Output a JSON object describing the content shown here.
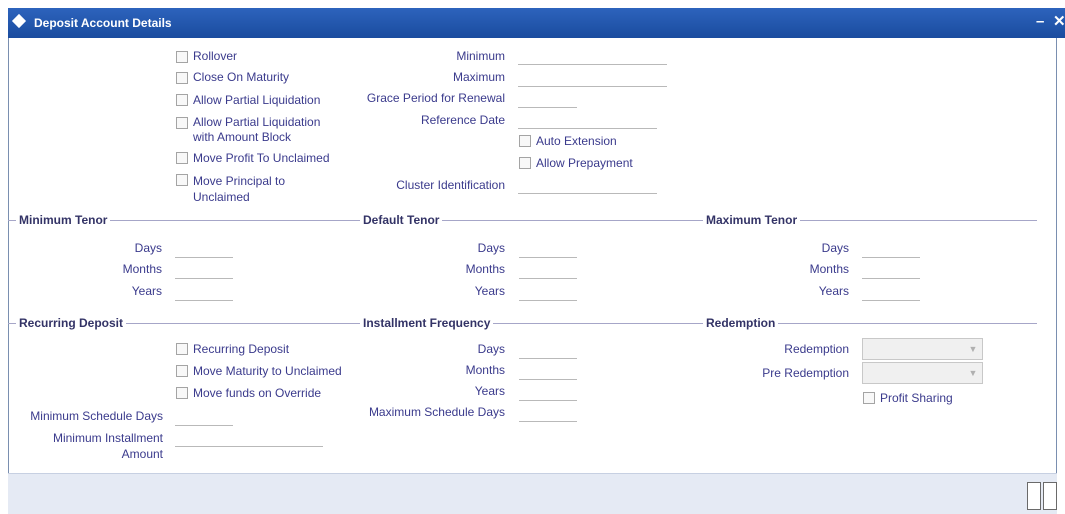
{
  "window": {
    "title": "Deposit Account Details",
    "minimize": "–",
    "close": "✕"
  },
  "flags": {
    "rollover": "Rollover",
    "close_on_maturity": "Close On Maturity",
    "allow_partial_liq": "Allow Partial Liquidation",
    "allow_partial_liq_block": "Allow Partial Liquidation\nwith Amount Block",
    "move_profit": "Move Profit To Unclaimed",
    "move_principal": "Move Principal to\nUnclaimed"
  },
  "fields": {
    "minimum": "Minimum",
    "maximum": "Maximum",
    "grace_period": "Grace Period for Renewal",
    "reference_date": "Reference Date",
    "auto_extension": "Auto Extension",
    "allow_prepayment": "Allow Prepayment",
    "cluster_id": "Cluster Identification"
  },
  "tenor": {
    "minimum_title": "Minimum Tenor",
    "default_title": "Default Tenor",
    "maximum_title": "Maximum Tenor",
    "days": "Days",
    "months": "Months",
    "years": "Years"
  },
  "recurring": {
    "title": "Recurring Deposit",
    "recurring_deposit": "Recurring Deposit",
    "move_maturity": "Move Maturity to Unclaimed",
    "move_funds": "Move funds on Override",
    "min_schedule_days": "Minimum Schedule Days",
    "min_installment": "Minimum Installment\nAmount"
  },
  "installment": {
    "title": "Installment Frequency",
    "days": "Days",
    "months": "Months",
    "years": "Years",
    "max_schedule_days": "Maximum Schedule Days"
  },
  "redemption": {
    "title": "Redemption",
    "redemption": "Redemption",
    "pre_redemption": "Pre Redemption",
    "profit_sharing": "Profit Sharing"
  }
}
